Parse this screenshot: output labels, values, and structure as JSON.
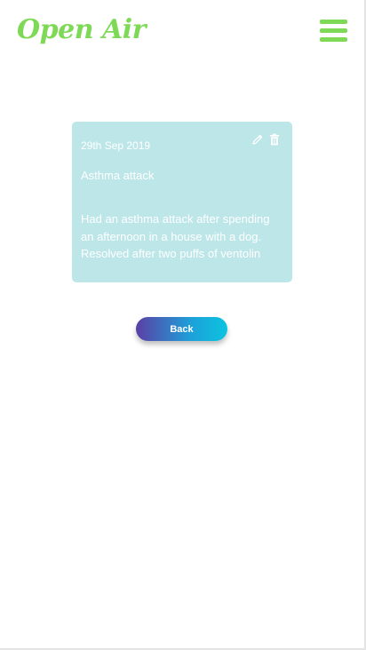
{
  "header": {
    "logo_text": "Open Air",
    "menu_icon": "hamburger-menu-icon"
  },
  "entry": {
    "date": "29th Sep 2019",
    "title": "Asthma attack",
    "description": "Had an asthma attack after spending an afternoon in a house with a dog. Resolved after two puffs of ventolin",
    "edit_icon": "pencil-icon",
    "delete_icon": "trash-icon"
  },
  "actions": {
    "back_label": "Back"
  },
  "colors": {
    "brand_green": "#7ed957",
    "card_background": "#bce6e8",
    "button_gradient_start": "#5b3fa6",
    "button_gradient_end": "#0bc4e0"
  }
}
